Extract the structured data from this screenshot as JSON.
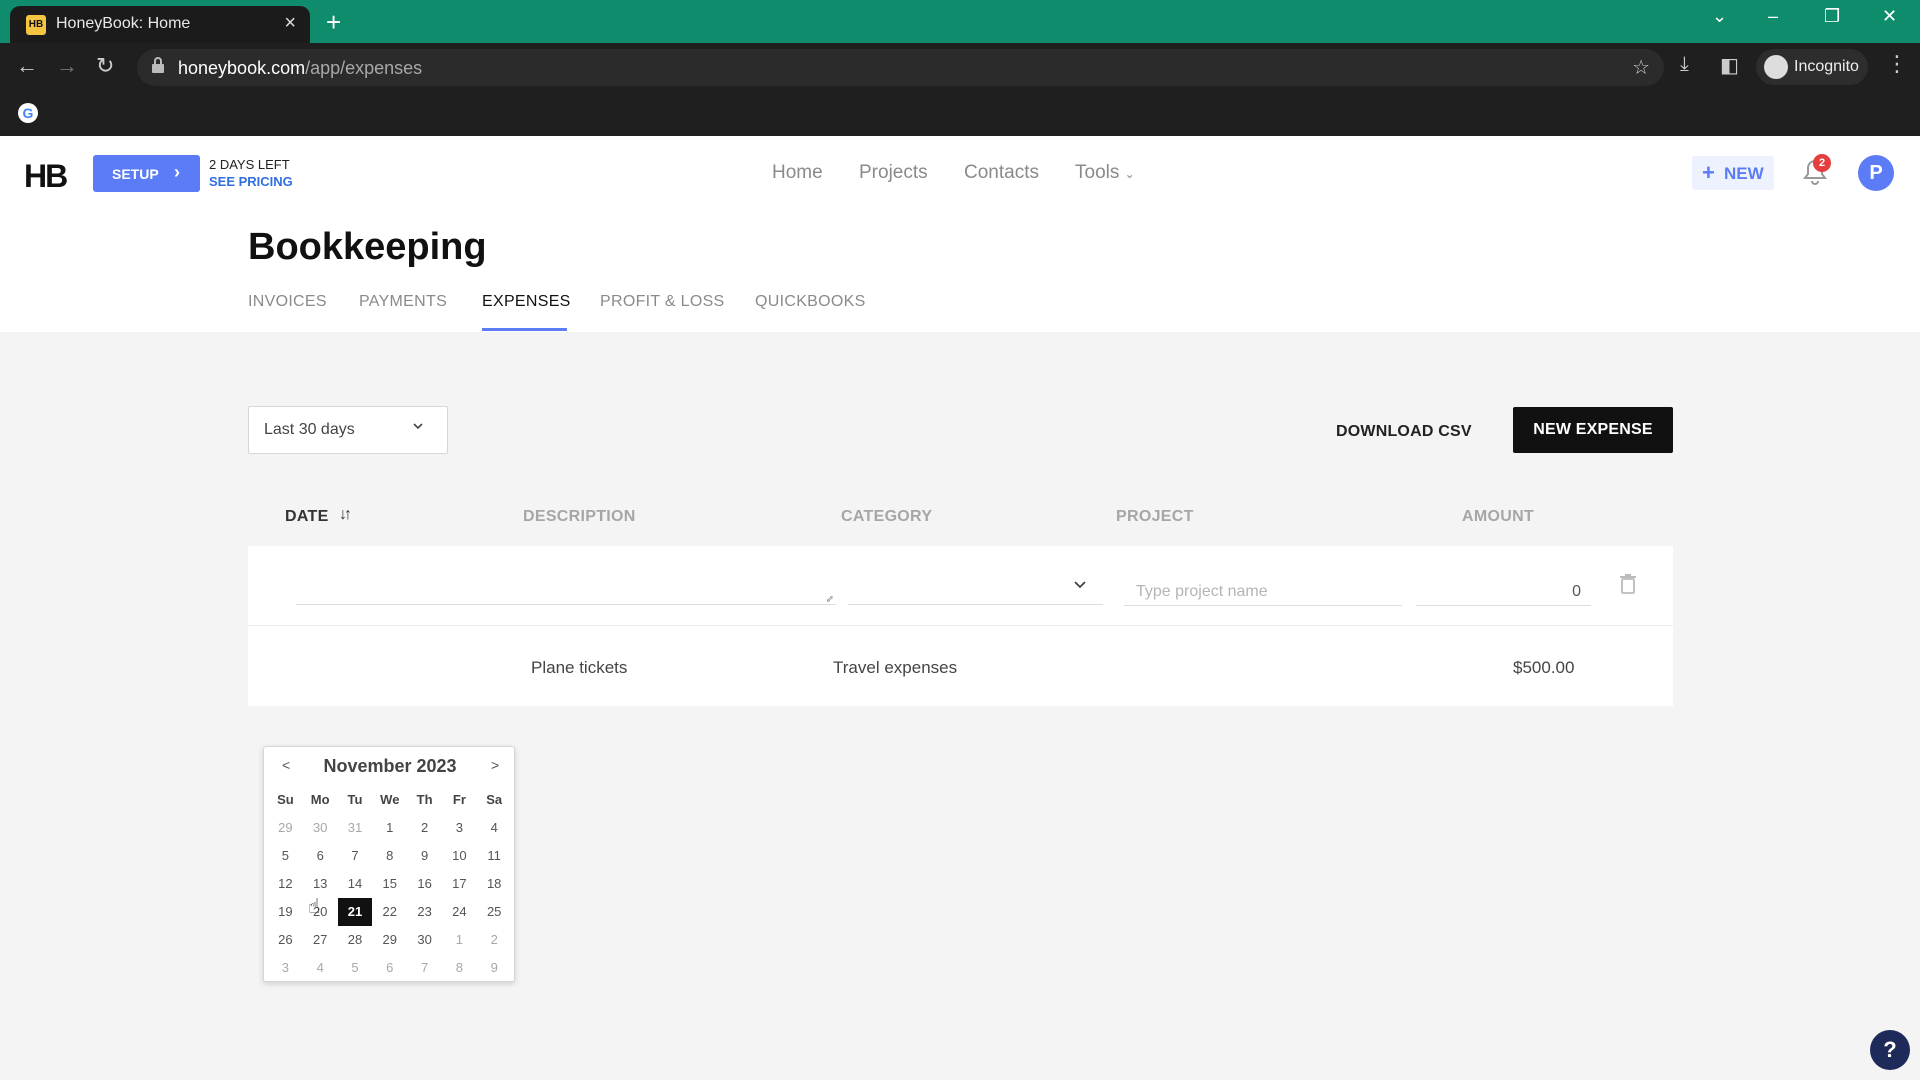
{
  "browser": {
    "tab_title": "HoneyBook: Home",
    "tab_favicon": "HB",
    "url_host": "honeybook.com",
    "url_path": "/app/expenses",
    "profile_label": "Incognito"
  },
  "header": {
    "logo": "HB",
    "setup_label": "SETUP",
    "days_left": "2 DAYS LEFT",
    "see_pricing": "SEE PRICING",
    "nav": [
      "Home",
      "Projects",
      "Contacts",
      "Tools"
    ],
    "new_label": "NEW",
    "notification_count": "2",
    "avatar_initial": "P",
    "accent_color": "#5b7cf6"
  },
  "page": {
    "title": "Bookkeeping",
    "tabs": [
      "INVOICES",
      "PAYMENTS",
      "EXPENSES",
      "PROFIT & LOSS",
      "QUICKBOOKS"
    ],
    "active_tab": "EXPENSES"
  },
  "toolbar": {
    "range_value": "Last 30 days",
    "download_csv": "DOWNLOAD CSV",
    "new_expense": "NEW EXPENSE"
  },
  "table": {
    "headers": [
      "DATE",
      "DESCRIPTION",
      "CATEGORY",
      "PROJECT",
      "AMOUNT"
    ],
    "edit_row": {
      "project_placeholder": "Type project name",
      "amount_value": "0"
    },
    "rows": [
      {
        "description": "Plane tickets",
        "category": "Travel expenses",
        "amount": "$500.00"
      }
    ]
  },
  "calendar": {
    "title": "November 2023",
    "prev": "<",
    "next": ">",
    "weekdays": [
      "Su",
      "Mo",
      "Tu",
      "We",
      "Th",
      "Fr",
      "Sa"
    ],
    "weeks": [
      [
        "29",
        "30",
        "31",
        "1",
        "2",
        "3",
        "4"
      ],
      [
        "5",
        "6",
        "7",
        "8",
        "9",
        "10",
        "11"
      ],
      [
        "12",
        "13",
        "14",
        "15",
        "16",
        "17",
        "18"
      ],
      [
        "19",
        "20",
        "21",
        "22",
        "23",
        "24",
        "25"
      ],
      [
        "26",
        "27",
        "28",
        "29",
        "30",
        "1",
        "2"
      ],
      [
        "3",
        "4",
        "5",
        "6",
        "7",
        "8",
        "9"
      ]
    ],
    "selected_day": "21"
  },
  "help_label": "?"
}
